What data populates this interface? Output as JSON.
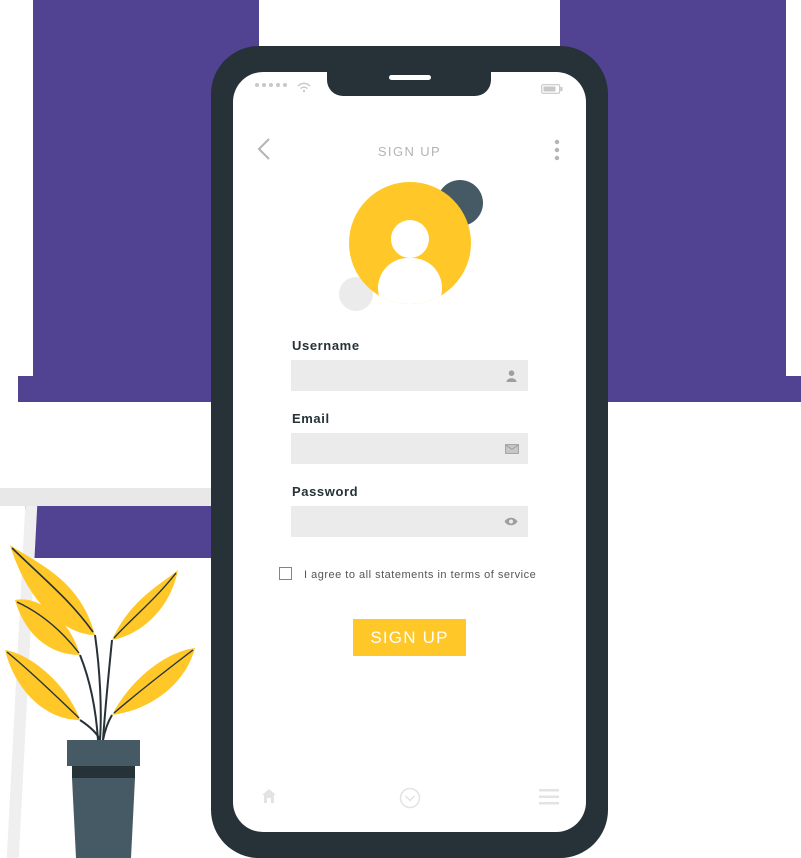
{
  "screen": {
    "title": "SIGN UP",
    "form": {
      "username_label": "Username",
      "email_label": "Email",
      "password_label": "Password",
      "username_value": "",
      "email_value": "",
      "password_value": ""
    },
    "terms_text": "I agree to all statements in terms of service",
    "terms_checked": false,
    "submit_label": "SIGN UP"
  },
  "icons": {
    "back": "chevron-left-icon",
    "more": "more-vertical-icon",
    "username": "user-icon",
    "email": "envelope-icon",
    "password": "eye-icon",
    "bottom_nav": [
      "home-icon",
      "chevron-circle-down-icon",
      "menu-icon"
    ],
    "status": [
      "signal-dots-icon",
      "wifi-icon",
      "battery-icon"
    ]
  },
  "colors": {
    "accent": "#ffc727",
    "phone_frame": "#263238",
    "background_panel": "#514391",
    "input_bg": "#ebebeb",
    "checkbox_border": "#6d7fd8",
    "avatar_dark_circle": "#455a64"
  }
}
